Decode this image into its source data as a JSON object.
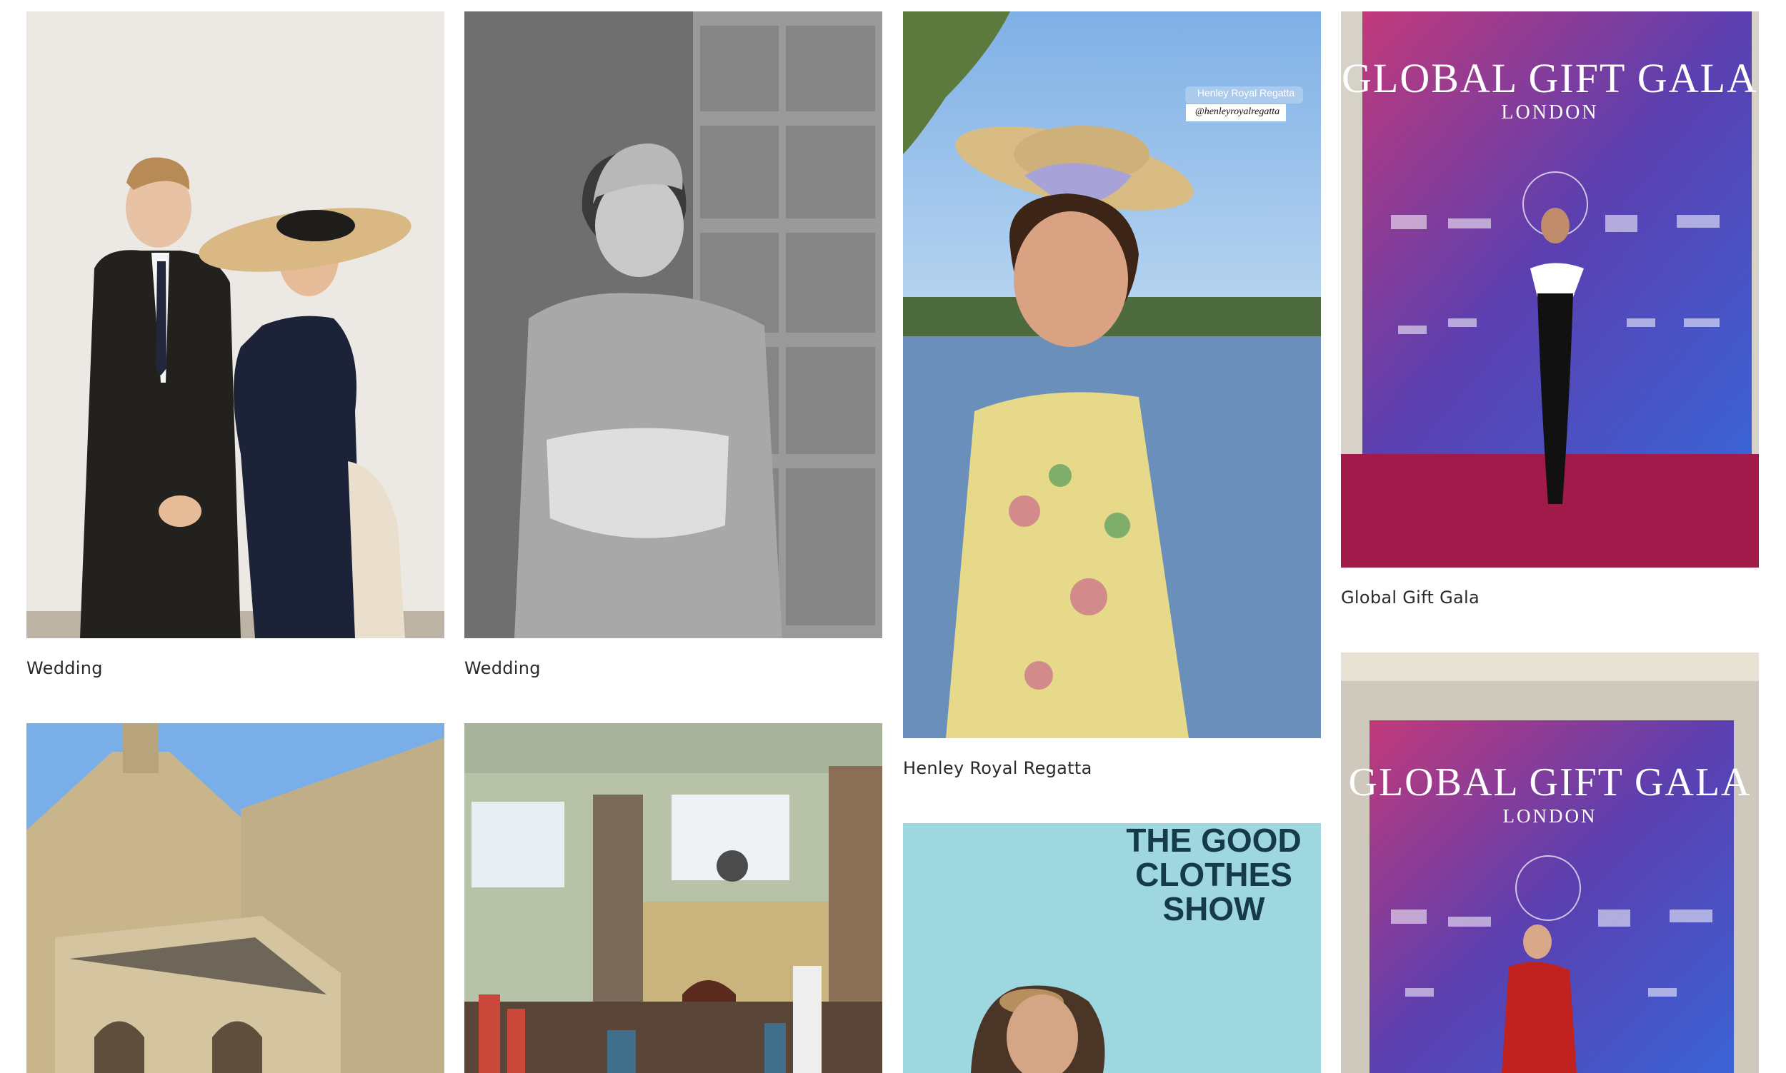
{
  "gallery": {
    "items": [
      {
        "caption": "Wedding"
      },
      {
        "caption": "Wedding"
      },
      {
        "caption": "Henley Royal Regatta",
        "tag_location": "Henley Royal Regatta",
        "tag_handle": "@henleyroyalregatta"
      },
      {
        "caption": "Global Gift Gala",
        "banner_title": "GLOBAL GIFT GALA",
        "banner_sub": "LONDON"
      },
      {
        "caption": ""
      },
      {
        "caption": ""
      },
      {
        "caption": "",
        "banner_title": "THE GOOD CLOTHES SHOW"
      },
      {
        "caption": "",
        "banner_title": "GLOBAL GIFT GALA",
        "banner_sub": "LONDON"
      }
    ]
  },
  "colors": {
    "wall_white": "#efedea",
    "suit_black": "#1f1d1b",
    "dress_navy": "#1c2238",
    "straw": "#d4b27f",
    "sky_blue": "#8fb9e6",
    "water": "#6d8fb8",
    "gala_pink": "#c2397a",
    "gala_purple": "#5b3fb0",
    "gala_blue": "#3a64d6",
    "carpet": "#a01a4a",
    "stone": "#c9b58c",
    "show_cyan": "#9fd7e0",
    "show_text": "#153a4a"
  }
}
